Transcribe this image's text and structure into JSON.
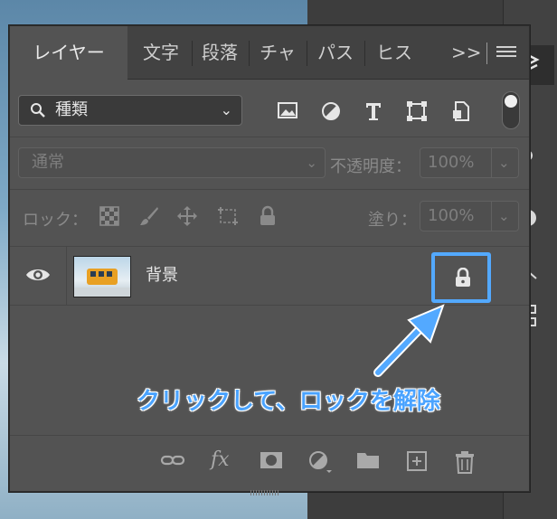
{
  "panel_tabs": [
    {
      "label": "レイヤー",
      "active": true
    },
    {
      "label": "文字",
      "active": false
    },
    {
      "label": "段落",
      "active": false
    },
    {
      "label": "チャ",
      "active": false
    },
    {
      "label": "パス",
      "active": false
    },
    {
      "label": "ヒス",
      "active": false
    }
  ],
  "tab_more_label": ">>",
  "filter": {
    "kind_label": "種類",
    "icons": [
      "image-filter-icon",
      "adjustment-filter-icon",
      "type-filter-icon",
      "shape-filter-icon",
      "smart-object-filter-icon"
    ],
    "toggle_on": true
  },
  "blend": {
    "mode_label": "通常",
    "opacity_label": "不透明度：",
    "opacity_value": "100%"
  },
  "lock": {
    "label": "ロック：",
    "icons": [
      "lock-transparent-pixels-icon",
      "lock-image-pixels-icon",
      "lock-position-icon",
      "lock-artboard-icon",
      "lock-all-icon"
    ],
    "fill_label": "塗り：",
    "fill_value": "100%"
  },
  "layer": {
    "name": "背景",
    "visible": true,
    "locked": true
  },
  "callout_text": "クリックして、ロックを解除",
  "bottom_icons": [
    "link-layers-icon",
    "fx-icon",
    "add-mask-icon",
    "adjustment-layer-icon",
    "new-group-icon",
    "new-layer-icon",
    "trash-icon"
  ],
  "colors": {
    "highlight": "#53a9ff",
    "panel_bg": "#535353",
    "tab_bar_bg": "#424242"
  }
}
